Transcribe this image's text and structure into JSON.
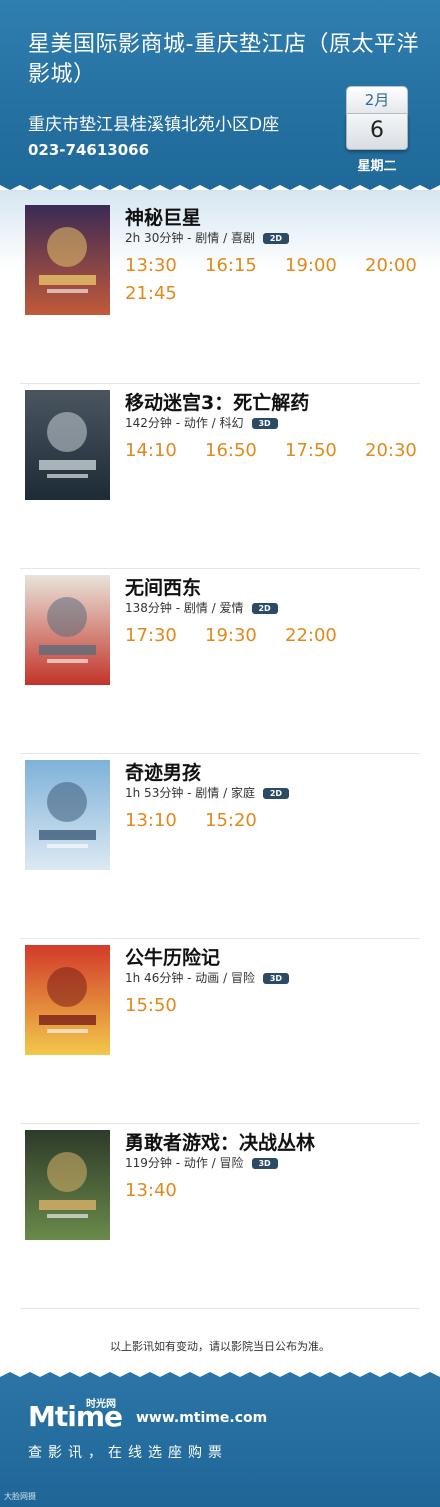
{
  "header": {
    "cinema_name": "星美国际影商城-重庆垫江店（原太平洋影城）",
    "address": "重庆市垫江县桂溪镇北苑小区D座",
    "phone": "023-74613066",
    "month": "2月",
    "day": "6",
    "weekday": "星期二"
  },
  "movies": [
    {
      "title": "神秘巨星",
      "meta": "2h 30分钟 - 剧情 / 喜剧",
      "format": "2D",
      "times": [
        "13:30",
        "16:15",
        "19:00",
        "20:00",
        "21:45"
      ]
    },
    {
      "title": "移动迷宫3：死亡解药",
      "meta": "142分钟 - 动作 / 科幻",
      "format": "3D",
      "times": [
        "14:10",
        "16:50",
        "17:50",
        "20:30"
      ]
    },
    {
      "title": "无间西东",
      "meta": "138分钟 - 剧情 / 爱情",
      "format": "2D",
      "times": [
        "17:30",
        "19:30",
        "22:00"
      ]
    },
    {
      "title": "奇迹男孩",
      "meta": "1h 53分钟 - 剧情 / 家庭",
      "format": "2D",
      "times": [
        "13:10",
        "15:20"
      ]
    },
    {
      "title": "公牛历险记",
      "meta": "1h 46分钟 - 动画 / 冒险",
      "format": "3D",
      "times": [
        "15:50"
      ]
    },
    {
      "title": "勇敢者游戏：决战丛林",
      "meta": "119分钟 - 动作 / 冒险",
      "format": "3D",
      "times": [
        "13:40"
      ]
    }
  ],
  "notice": "以上影讯如有变动，请以影院当日公布为准。",
  "footer": {
    "logo_m": "Mtime",
    "logo_cn": "时光网",
    "url": "www.mtime.com",
    "slogan": "查影讯，在线选座购票",
    "corner": "大脸网摄"
  },
  "colors": {
    "header_blue": "#2672a3",
    "showtime_orange": "#e08a1d",
    "badge_dark": "#2a4a66"
  }
}
